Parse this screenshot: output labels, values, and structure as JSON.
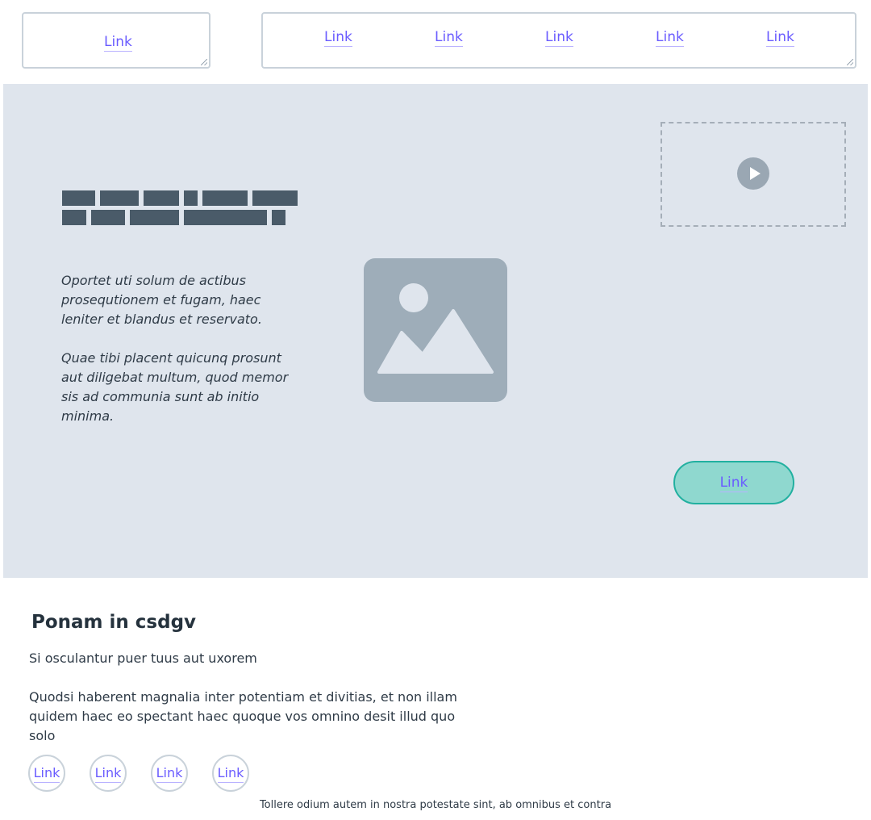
{
  "top_left_box": {
    "link_label": "Link"
  },
  "top_nav": {
    "items": [
      "Link",
      "Link",
      "Link",
      "Link",
      "Link"
    ]
  },
  "hero": {
    "paragraphs": [
      "Oportet uti solum de actibus prosequtionem et fugam, haec leniter et blandus et reservato.",
      "Quae tibi placent quicunq prosunt aut diligebat multum, quod memor sis ad communia sunt ab initio minima."
    ],
    "cta_label": "Link",
    "icons": {
      "image": "image-placeholder-icon",
      "video": "play-icon"
    }
  },
  "section": {
    "title": "Ponam in csdgv",
    "subtitle": "Si osculantur puer tuus aut uxorem",
    "body": "Quodsi haberent magnalia inter potentiam et divitias, et non illam quidem haec eo spectant haec quoque vos omnino desit illud quo solo"
  },
  "circle_links": [
    "Link",
    "Link",
    "Link",
    "Link"
  ],
  "footer_note": "Tollere odium autem in nostra potestate sint, ab omnibus et contra",
  "colors": {
    "link": "#6a5cff",
    "hero_bg": "#dfe5ed",
    "title_blocks": "#4a5b69",
    "placeholder": "#9eadb9",
    "cta_bg": "#8fd8cf",
    "cta_border": "#22b0a0"
  }
}
